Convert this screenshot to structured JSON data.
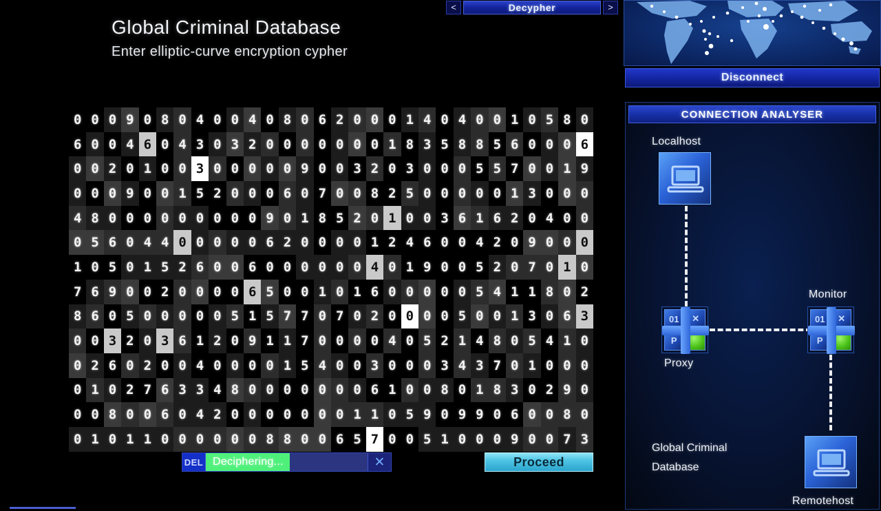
{
  "nav": {
    "prev_label": "<",
    "next_label": ">",
    "title": "Decypher"
  },
  "header": {
    "title": "Global Criminal Database",
    "subtitle": "Enter elliptic-curve encryption cypher"
  },
  "cypher_grid": {
    "rows": 14,
    "cols": 30,
    "digits": [
      "000908040040806200014040010580",
      "600460430320000000183588560006",
      "002010030000090032030005570019",
      "000900152000607008250000013000",
      "480000000009018520100361620400",
      "056044000006200001246004209000",
      "105015260060000004019005207010",
      "769002000065001016000005411802",
      "860500000515770702000050013063",
      "003203612091170000405214805410",
      "026020040000154003000343701000",
      "010276334800000006100801830290",
      "008006042000000011059099060080",
      "010110000008800657005100090073"
    ],
    "highlighted": [
      {
        "row": 1,
        "col": 4
      },
      {
        "row": 1,
        "col": 29
      },
      {
        "row": 2,
        "col": 7
      },
      {
        "row": 4,
        "col": 18
      },
      {
        "row": 5,
        "col": 6
      },
      {
        "row": 5,
        "col": 29
      },
      {
        "row": 6,
        "col": 17
      },
      {
        "row": 6,
        "col": 28
      },
      {
        "row": 7,
        "col": 10
      },
      {
        "row": 8,
        "col": 19
      },
      {
        "row": 8,
        "col": 29
      },
      {
        "row": 9,
        "col": 2
      },
      {
        "row": 9,
        "col": 5
      },
      {
        "row": 13,
        "col": 17
      }
    ]
  },
  "input_bar": {
    "delete_label": "DEL",
    "status_text": "Deciphering...",
    "progress_percent": 52,
    "close_label": "✕"
  },
  "proceed_button": {
    "label": "Proceed"
  },
  "right_panel": {
    "disconnect_label": "Disconnect",
    "analyser_title": "CONNECTION ANALYSER",
    "nodes": {
      "localhost": "Localhost",
      "proxy": "Proxy",
      "monitor": "Monitor",
      "remotehost": "Remotehost",
      "database_line1": "Global Criminal",
      "database_line2": "Database"
    },
    "router_quadrants": [
      "01",
      "✕",
      "P",
      "●"
    ]
  },
  "colors": {
    "accent_blue": "#1426a0",
    "proceed_cyan": "#4fc4e4",
    "progress_green": "#4ef07a",
    "panel_bg": "#071331",
    "grid_digit": "#f4f4f4"
  }
}
